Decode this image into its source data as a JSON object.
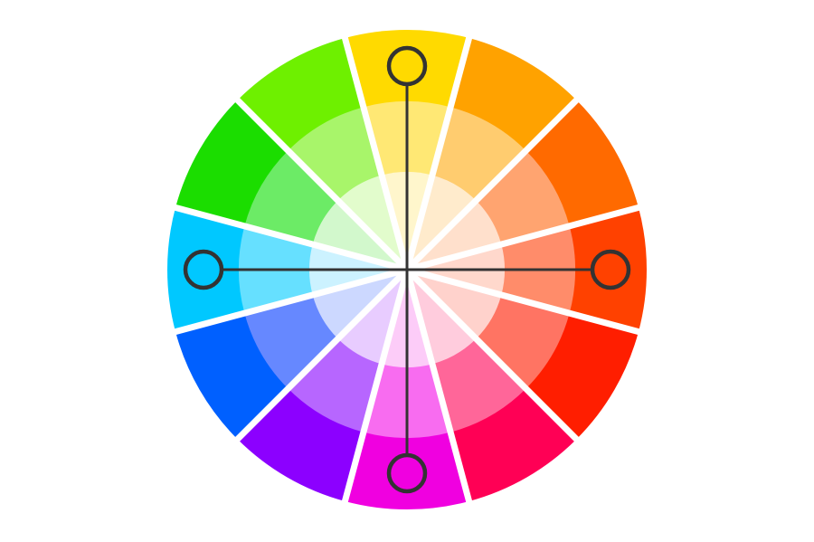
{
  "diagram": {
    "type": "color-wheel",
    "scheme": "tetradic-square",
    "segments": [
      {
        "name": "yellow",
        "colors": [
          "#FFDA00",
          "#FFE874",
          "#FFF6CC"
        ]
      },
      {
        "name": "yellow-orange",
        "colors": [
          "#FFA200",
          "#FFCC6F",
          "#FFEBCC"
        ]
      },
      {
        "name": "orange",
        "colors": [
          "#FF6A00",
          "#FFA470",
          "#FFE0CC"
        ]
      },
      {
        "name": "red-orange",
        "colors": [
          "#FF4100",
          "#FF8C6A",
          "#FFD8CC"
        ]
      },
      {
        "name": "red",
        "colors": [
          "#FF1E00",
          "#FF7463",
          "#FFD2CC"
        ]
      },
      {
        "name": "red-magenta",
        "colors": [
          "#FF0055",
          "#FF6699",
          "#FFCCDD"
        ]
      },
      {
        "name": "magenta",
        "colors": [
          "#F000E0",
          "#F86CF0",
          "#FCCCF8"
        ]
      },
      {
        "name": "violet",
        "colors": [
          "#8C00FF",
          "#B766FF",
          "#E8CCFF"
        ]
      },
      {
        "name": "blue",
        "colors": [
          "#0060FF",
          "#6688FF",
          "#CCD8FF"
        ]
      },
      {
        "name": "cyan",
        "colors": [
          "#00C8FF",
          "#66E0FF",
          "#CCF2FF"
        ]
      },
      {
        "name": "green",
        "colors": [
          "#1BDD00",
          "#6CEB66",
          "#D2F8CC"
        ]
      },
      {
        "name": "yellow-green",
        "colors": [
          "#6EF000",
          "#A8F56A",
          "#E2FCCC"
        ]
      }
    ],
    "selected_segments": [
      "yellow",
      "red-orange",
      "magenta",
      "cyan"
    ],
    "marker_color": "#333333",
    "gap_color": "#ffffff"
  }
}
